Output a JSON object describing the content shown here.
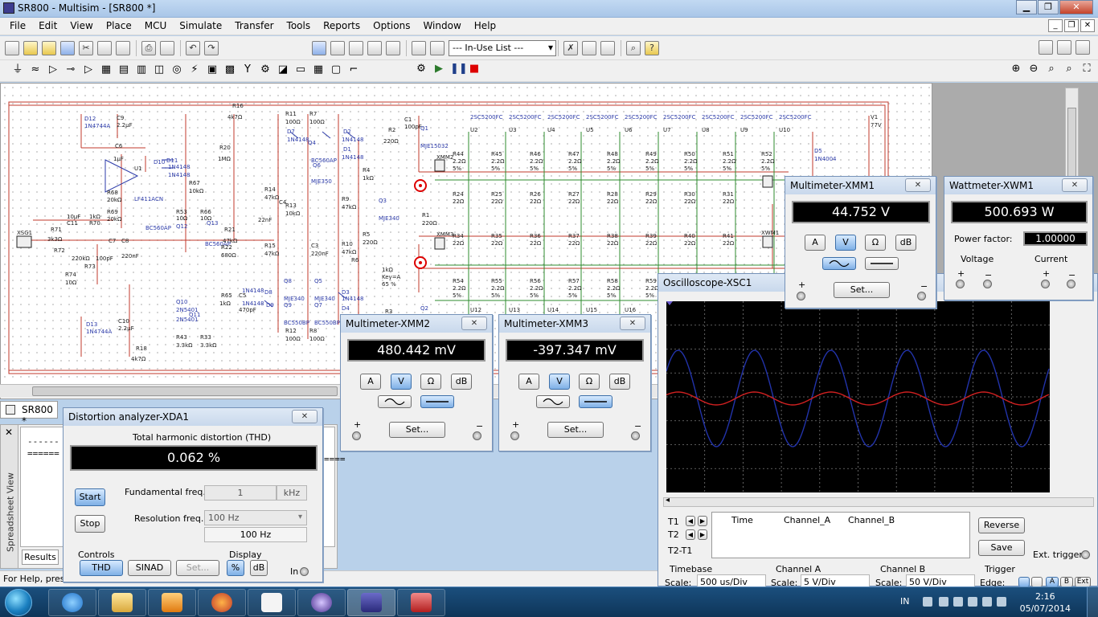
{
  "window": {
    "title": "SR800 - Multisim - [SR800 *]"
  },
  "menu": {
    "items": [
      "File",
      "Edit",
      "View",
      "Place",
      "MCU",
      "Simulate",
      "Transfer",
      "Tools",
      "Reports",
      "Options",
      "Window",
      "Help"
    ]
  },
  "toolbar": {
    "inuse_list": "--- In-Use List ---"
  },
  "schematic": {
    "labels": {
      "d12": "D12",
      "d12_part": "1N4744A",
      "c9": "C9",
      "c9_val": "2.2µF",
      "c6": "C6",
      "c6_val": "1µF",
      "u1": "U1",
      "u1_part": "LF411ACN",
      "d10": "D10",
      "d11": "D11",
      "d10_part": "1N4148",
      "d11_part": "1N4148",
      "r16": "R16",
      "r16_val": "4k7Ω",
      "r20": "R20",
      "r20_val": "1MΩ",
      "r67": "R67",
      "r67_val": "10kΩ",
      "r68": "R68",
      "r68_val": "20kΩ",
      "r69": "R69",
      "r69_val": "20kΩ",
      "r71": "R71",
      "r71_val": "3k3Ω",
      "c11": "C11",
      "c11_val": "10µF",
      "r70": "R70",
      "r70_val": "1kΩ",
      "r72": "R72",
      "r72_val": "220kΩ",
      "c7": "C7",
      "c8": "C8",
      "c7_val": "100pF",
      "c8_val": "220nF",
      "r73": "R73",
      "r74": "R74",
      "r74_val": "10Ω",
      "xsg1": "XSG1",
      "d13": "D13",
      "d13_part": "1N4744A",
      "c10": "C10",
      "c10_val": "2.2µF",
      "r18": "R18",
      "r18_val": "4k7Ω",
      "r53": "R53",
      "r53_val": "10Ω",
      "q12": "Q12",
      "q12_part": "BC560AP",
      "r66": "R66",
      "r66_val": "10Ω",
      "q13": "Q13",
      "q13_part": "BC560AP",
      "r21": "R21",
      "r21_val": "47kΩ",
      "r22": "R22",
      "r22_val": "680Ω",
      "q10": "Q10",
      "q10_part": "2N5401",
      "q11": "Q11",
      "q11_part": "2N5401",
      "r43": "R43",
      "r43_val": "3.3kΩ",
      "r33": "R33",
      "r33_val": "3.3kΩ",
      "r11": "R11",
      "r11_val": "100Ω",
      "r7": "R7",
      "r7_val": "100Ω",
      "d7": "D7",
      "d7_part": "1N4148",
      "q4": "Q4",
      "q6": "Q6",
      "q4_part": "BC560AP",
      "q6_part": "MJE350",
      "d2": "D2",
      "d1": "D1",
      "d2_part": "1N4148",
      "d1_part": "1N4148",
      "r14": "R14",
      "r14_val": "47kΩ",
      "c4": "C4",
      "c4_val": "22nF",
      "r13": "R13",
      "r13_val": "10kΩ",
      "r15": "R15",
      "r15_val": "47kΩ",
      "c3": "C3",
      "c3_val": "220nF",
      "r12": "R12",
      "r12_val": "100Ω",
      "r8": "R8",
      "r8_val": "100Ω",
      "q8": "Q8",
      "q9": "Q9",
      "q5": "Q5",
      "q7": "Q7",
      "q8_part": "MJE340",
      "q9_part": "BC550BP",
      "q5_part": "MJE340",
      "q7_part": "BC550BP",
      "d8": "D8",
      "d9": "D9",
      "d8_part": "1N4148",
      "d9_part": "1N4148",
      "c5": "C5",
      "c5_val": "470pF",
      "r65": "R65",
      "r65_val": "1kΩ",
      "d3": "D3",
      "d4": "D4",
      "d3_part": "1N4148",
      "r9": "R9",
      "r9_val": "47kΩ",
      "r4": "R4",
      "r4_val": "1kΩ",
      "q3": "Q3",
      "q3_part": "MJE340",
      "r10": "R10",
      "r10_val": "47kΩ",
      "r6": "R6",
      "r3": "R3",
      "r5": "R5",
      "r5_val": "220Ω",
      "pot": "1kΩ",
      "pot_key": "Key=A",
      "pot_pct": "65 %",
      "c1": "C1",
      "c1_val": "100pF",
      "r2": "R2",
      "r2_val": "220Ω",
      "q1": "Q1",
      "q1_part": "MJE15032",
      "r1": "R1",
      "r1_val": "220Ω",
      "q2": "Q2",
      "v1": "V1",
      "v1_val": "77V",
      "d5": "D5",
      "d5_part": "1N4004",
      "xmm1": "XMM1",
      "xmm2": "XMM2",
      "xmm3": "XMM3",
      "xwm1": "XWM1"
    },
    "output_transistors": {
      "part": "2SC5200FC",
      "top_names": [
        "U2",
        "U3",
        "U4",
        "U5",
        "U6",
        "U7",
        "U8",
        "U9",
        "U10"
      ],
      "bottom_names": [
        "U12",
        "U13",
        "U14",
        "U15",
        "U16"
      ]
    },
    "emitter_resistors": {
      "row1": [
        "R44",
        "R45",
        "R46",
        "R47",
        "R48",
        "R49",
        "R50",
        "R51",
        "R52"
      ],
      "row2": [
        "R24",
        "R25",
        "R26",
        "R27",
        "R28",
        "R29",
        "R30",
        "R31"
      ],
      "row3": [
        "R34",
        "R35",
        "R36",
        "R37",
        "R38",
        "R39",
        "R40",
        "R41"
      ],
      "row4": [
        "R54",
        "R55",
        "R56",
        "R57",
        "R58",
        "R59"
      ],
      "val_small": "2.2Ω",
      "val_pct": "5%",
      "val_base": "22Ω"
    }
  },
  "doc_tab": "SR800 *",
  "spreadsheet": {
    "label": "Spreadsheet View",
    "line1": "------ Ch",
    "line2": "======",
    "line2_tail": "====",
    "results_tab": "Results"
  },
  "status": "For Help, press",
  "distortion": {
    "title": "Distortion analyzer-XDA1",
    "thd_label": "Total harmonic distortion (THD)",
    "value": "0.062 %",
    "start": "Start",
    "stop": "Stop",
    "fund_label": "Fundamental freq.",
    "fund_value": "1",
    "fund_unit": "kHz",
    "res_label": "Resolution freq.",
    "res_value": "100 Hz",
    "res_display": "100 Hz",
    "controls_label": "Controls",
    "display_label": "Display",
    "thd_btn": "THD",
    "sinad_btn": "SINAD",
    "set_btn": "Set...",
    "pct_btn": "%",
    "db_btn": "dB",
    "in_label": "In"
  },
  "xmm2": {
    "title": "Multimeter-XMM2",
    "value": "480.442 mV"
  },
  "xmm3": {
    "title": "Multimeter-XMM3",
    "value": "-397.347 mV"
  },
  "xmm1": {
    "title": "Multimeter-XMM1",
    "value": "44.752 V"
  },
  "meter_buttons": {
    "a": "A",
    "v": "V",
    "ohm": "Ω",
    "db": "dB",
    "set": "Set...",
    "plus": "+",
    "minus": "−"
  },
  "wattmeter": {
    "title": "Wattmeter-XWM1",
    "value": "500.693 W",
    "pf_label": "Power factor:",
    "pf_value": "1.00000",
    "voltage": "Voltage",
    "current": "Current"
  },
  "scope": {
    "title": "Oscilloscope-XSC1",
    "t1": "T1",
    "t2": "T2",
    "t2t1": "T2-T1",
    "col_time": "Time",
    "col_a": "Channel_A",
    "col_b": "Channel_B",
    "reverse": "Reverse",
    "save": "Save",
    "ext_trigger": "Ext. trigger",
    "timebase": "Timebase",
    "scale1": "Scale:",
    "timebase_value": "500 us/Div",
    "channel_a": "Channel A",
    "scale2": "Scale:",
    "cha_value": "5  V/Div",
    "channel_b": "Channel B",
    "scale3": "Scale:",
    "chb_value": "50  V/Div",
    "trigger": "Trigger",
    "edge": "Edge:",
    "trace_a_color": "#d02020",
    "trace_b_color": "#2233aa"
  },
  "taskbar": {
    "lang": "IN",
    "time": "2:16",
    "date": "05/07/2014"
  }
}
